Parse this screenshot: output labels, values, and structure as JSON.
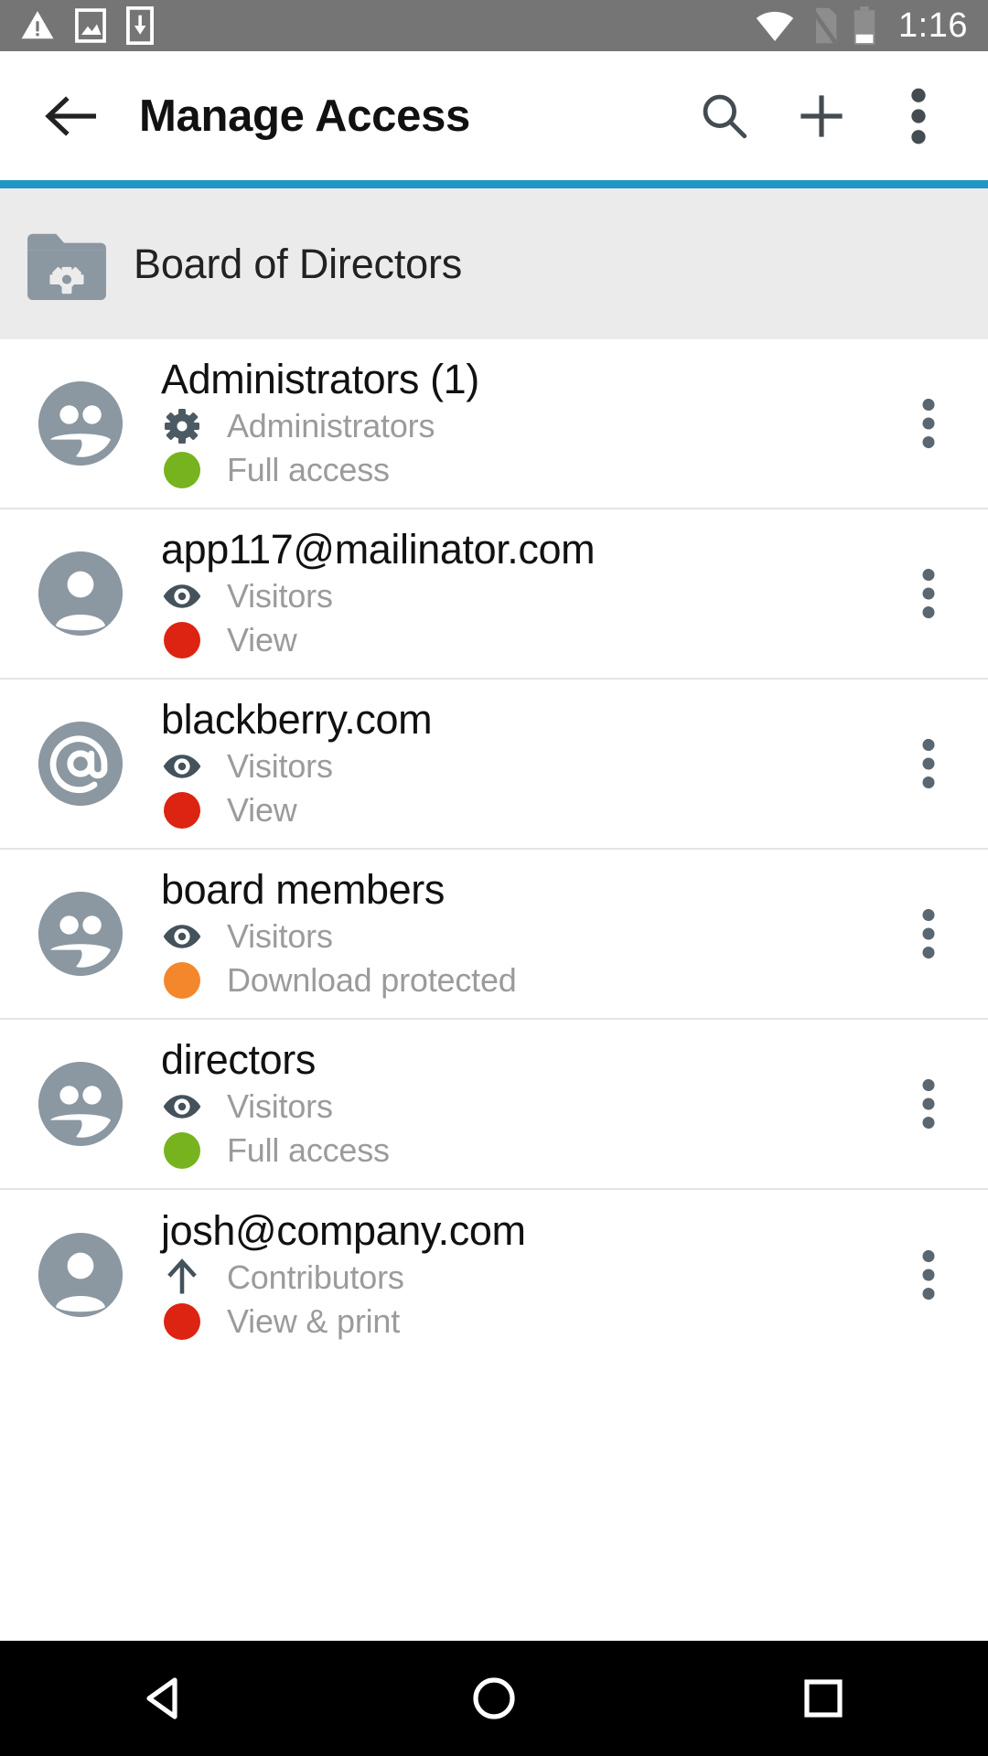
{
  "status_bar": {
    "icons_left": [
      "warning-triangle-icon",
      "screenshot-image-icon",
      "download-to-device-icon"
    ],
    "icons_right": [
      "wifi-icon",
      "no-sim-icon",
      "battery-icon"
    ],
    "time": "1:16",
    "background_color": "#757575"
  },
  "toolbar": {
    "back_label": "back-arrow",
    "title": "Manage Access",
    "search_label": "search-icon",
    "add_label": "add-icon",
    "overflow_label": "more-options-icon",
    "accent_color": "#2196c4"
  },
  "folder_header": {
    "icon": "folder-settings-icon",
    "name": "Board of Directors",
    "background_color": "#ebebeb"
  },
  "colors": {
    "green": "#76b31f",
    "red": "#dd2312",
    "orange": "#f4872c",
    "avatar_grey": "#8b97a1",
    "meta_grey": "#9b9b9b"
  },
  "access_list": [
    {
      "name": "Administrators (1)",
      "avatar": "group-avatar",
      "role_icon": "gear-icon",
      "role": "Administrators",
      "permission": "Full access",
      "permission_color": "#76b31f"
    },
    {
      "name": "app117@mailinator.com",
      "avatar": "person-avatar",
      "role_icon": "eye-icon",
      "role": "Visitors",
      "permission": "View",
      "permission_color": "#dd2312"
    },
    {
      "name": "blackberry.com",
      "avatar": "at-sign-avatar",
      "role_icon": "eye-icon",
      "role": "Visitors",
      "permission": "View",
      "permission_color": "#dd2312"
    },
    {
      "name": "board members",
      "avatar": "group-avatar",
      "role_icon": "eye-icon",
      "role": "Visitors",
      "permission": "Download protected",
      "permission_color": "#f4872c"
    },
    {
      "name": "directors",
      "avatar": "group-avatar",
      "role_icon": "eye-icon",
      "role": "Visitors",
      "permission": "Full access",
      "permission_color": "#76b31f"
    },
    {
      "name": "josh@company.com",
      "avatar": "person-avatar",
      "role_icon": "up-arrow-icon",
      "role": "Contributors",
      "permission": "View & print",
      "permission_color": "#dd2312"
    }
  ],
  "nav_bar": {
    "back": "nav-back-triangle",
    "home": "nav-home-circle",
    "recents": "nav-recents-square"
  }
}
